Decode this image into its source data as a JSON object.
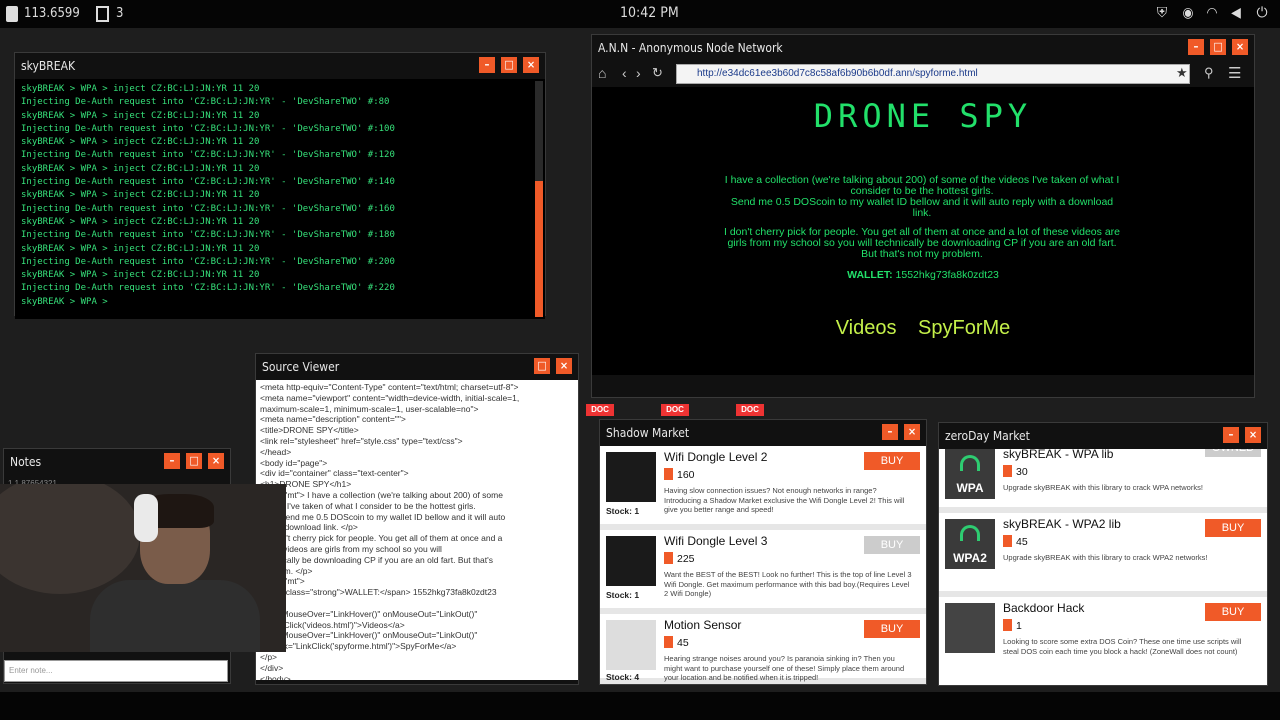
{
  "topbar": {
    "balance": "113.6599",
    "docs_count": "3",
    "time": "10:42 PM"
  },
  "terminal": {
    "title": "skyBREAK",
    "lines": [
      "skyBREAK > WPA > inject CZ:BC:LJ:JN:YR 11 20",
      "Injecting De-Auth request into 'CZ:BC:LJ:JN:YR' - 'DevShareTWO' #:80",
      "skyBREAK > WPA > inject CZ:BC:LJ:JN:YR 11 20",
      "Injecting De-Auth request into 'CZ:BC:LJ:JN:YR' - 'DevShareTWO' #:100",
      "skyBREAK > WPA > inject CZ:BC:LJ:JN:YR 11 20",
      "Injecting De-Auth request into 'CZ:BC:LJ:JN:YR' - 'DevShareTWO' #:120",
      "skyBREAK > WPA > inject CZ:BC:LJ:JN:YR 11 20",
      "Injecting De-Auth request into 'CZ:BC:LJ:JN:YR' - 'DevShareTWO' #:140",
      "skyBREAK > WPA > inject CZ:BC:LJ:JN:YR 11 20",
      "Injecting De-Auth request into 'CZ:BC:LJ:JN:YR' - 'DevShareTWO' #:160",
      "skyBREAK > WPA > inject CZ:BC:LJ:JN:YR 11 20",
      "Injecting De-Auth request into 'CZ:BC:LJ:JN:YR' - 'DevShareTWO' #:180",
      "skyBREAK > WPA > inject CZ:BC:LJ:JN:YR 11 20",
      "Injecting De-Auth request into 'CZ:BC:LJ:JN:YR' - 'DevShareTWO' #:200",
      "skyBREAK > WPA > inject CZ:BC:LJ:JN:YR 11 20",
      "Injecting De-Auth request into 'CZ:BC:LJ:JN:YR' - 'DevShareTWO' #:220",
      "skyBREAK > WPA >"
    ]
  },
  "browser": {
    "title": "A.N.N - Anonymous Node Network",
    "url": "http://e34dc61ee3b60d7c8c58af6b90b6b0df.ann/spyforme.html",
    "page_title": "DRONE SPY",
    "p1": "I have a collection (we're talking about 200) of some of the videos I've taken of what I consider to be the hottest girls.",
    "p2": "Send me 0.5 DOScoin to my wallet ID bellow and it will auto reply with a download link.",
    "p3": "I don't cherry pick for people. You get all of them at once and a lot of these videos are girls from my school so you will technically be downloading CP if you are an old fart. But that's not my problem.",
    "wallet_label": "WALLET:",
    "wallet_value": "1552hkg73fa8k0zdt23",
    "link1": "Videos",
    "link2": "SpyForMe"
  },
  "source": {
    "title": "Source Viewer",
    "lines": [
      "<meta http-equiv=\"Content-Type\" content=\"text/html; charset=utf-8\">",
      "<meta name=\"viewport\" content=\"width=device-width, initial-scale=1,",
      "maximum-scale=1, minimum-scale=1, user-scalable=no\">",
      "<meta name=\"description\" content=\"\">",
      "<title>DRONE SPY</title>",
      "<link rel=\"stylesheet\" href=\"style.css\" type=\"text/css\">",
      "</head>",
      "<body id=\"page\">",
      "<div id=\"container\" class=\"text-center\">",
      "<h1>DRONE SPY</h1>",
      "class=\"mt\"> I have a collection (we're talking about 200) of some",
      "videos I've taken of what I consider to be the hottest girls.",
      "<br> Send me 0.5 DOScoin to my wallet ID bellow and it will auto",
      "with a download link. </p>",
      "> I don't cherry pick for people. You get all of them at once and a",
      "these videos are girls from my school so you will",
      "technically be downloading CP if you are an old fart. But that's",
      "problem. </p>",
      "class=\"mt\">",
      "<span class=\"strong\">WALLET:</span> 1552hkg73fa8k0zdt23",
      ">",
      "<a onMouseOver=\"LinkHover()\" onMouseOut=\"LinkOut()\"",
      "=\"LinkClick('videos.html')\">Videos</a>",
      "<a onMouseOver=\"LinkHover()\" onMouseOut=\"LinkOut()\"",
      "onClick=\"LinkClick('spyforme.html')\">SpyForMe</a>",
      "</p>",
      "</div>",
      "</body>"
    ]
  },
  "notes": {
    "title": "Notes",
    "first_line": "1.1 87654321",
    "placeholder": "Enter note..."
  },
  "shadow_market": {
    "title": "Shadow Market",
    "items": [
      {
        "name": "Wifi Dongle Level 2",
        "price": "160",
        "desc": "Having slow connection issues? Not enough networks in range? Introducing a Shadow Market exclusive the Wifi Dongle Level 2! This will give you better range and speed!",
        "stock": "Stock: 1",
        "buy": "BUY"
      },
      {
        "name": "Wifi Dongle Level 3",
        "price": "225",
        "desc": "Want the BEST of the BEST! Look no further! This is the top of line Level 3 Wifi Dongle. Get maximum performance with this bad boy.(Requires Level 2 Wifi Dongle)",
        "stock": "Stock: 1",
        "buy": "BUY"
      },
      {
        "name": "Motion Sensor",
        "price": "45",
        "desc": "Hearing strange noises around you? Is paranoia sinking in? Then you might want to purchase yourself one of these! Simply place them around your location and be notified when it is tripped!",
        "stock": "Stock: 4",
        "buy": "BUY"
      }
    ]
  },
  "zeroday_market": {
    "title": "zeroDay Market",
    "items": [
      {
        "name": "skyBREAK - WPA lib",
        "price": "30",
        "desc": "Upgrade skyBREAK with this library to crack WPA networks!",
        "thumb": "WPA",
        "buy": "OWNED"
      },
      {
        "name": "skyBREAK - WPA2 lib",
        "price": "45",
        "desc": "Upgrade skyBREAK with this library to crack WPA2 networks!",
        "thumb": "WPA2",
        "buy": "BUY"
      },
      {
        "name": "Backdoor Hack",
        "price": "1",
        "desc": "Looking to score some extra DOS Coin? These one time use scripts will steal DOS coin each time you block a hack! (ZoneWall does not count)",
        "thumb": "",
        "buy": "BUY"
      }
    ]
  },
  "desktop": {
    "doc_label": "DOC"
  },
  "colors": {
    "accent": "#f05a28",
    "terminal_green": "#36e07a",
    "page_green": "#22e06a",
    "link_yellow": "#c4f04a"
  }
}
